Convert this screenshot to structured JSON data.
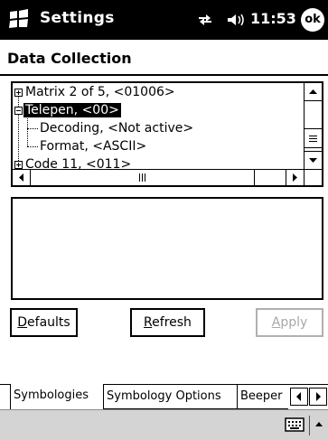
{
  "titlebar": {
    "app_title": "Settings",
    "clock": "11:53",
    "ok_label": "ok",
    "icons": [
      "windows-start-icon",
      "connectivity-icon",
      "volume-icon"
    ]
  },
  "page": {
    "title": "Data Collection"
  },
  "tree": {
    "items": [
      {
        "label": "Matrix 2 of 5, <01006>",
        "expander": "plus",
        "level": 0,
        "selected": false
      },
      {
        "label": "Telepen, <00>",
        "expander": "minus",
        "level": 0,
        "selected": true
      },
      {
        "label": "Decoding, <Not active>",
        "expander": "none",
        "level": 1,
        "selected": false
      },
      {
        "label": "Format, <ASCII>",
        "expander": "none",
        "level": 1,
        "selected": false
      },
      {
        "label": "Code 11, <011>",
        "expander": "plus",
        "level": 0,
        "selected": false
      }
    ]
  },
  "buttons": {
    "defaults": {
      "first": "D",
      "rest": "efaults"
    },
    "refresh": {
      "first": "R",
      "rest": "efresh"
    },
    "apply": {
      "first": "A",
      "rest": "pply"
    }
  },
  "tabs": [
    {
      "label": "Symbologies",
      "active": true
    },
    {
      "label": "Symbology Options",
      "active": false
    },
    {
      "label": "Beeper",
      "active": false
    }
  ],
  "cmdbar": {
    "icons": [
      "keyboard-icon",
      "sip-up-arrow-icon"
    ]
  },
  "colors": {
    "titlebar_bg": "#000000",
    "cmdbar_bg": "#d4d4d4",
    "disabled_text": "#a8a8a8"
  }
}
